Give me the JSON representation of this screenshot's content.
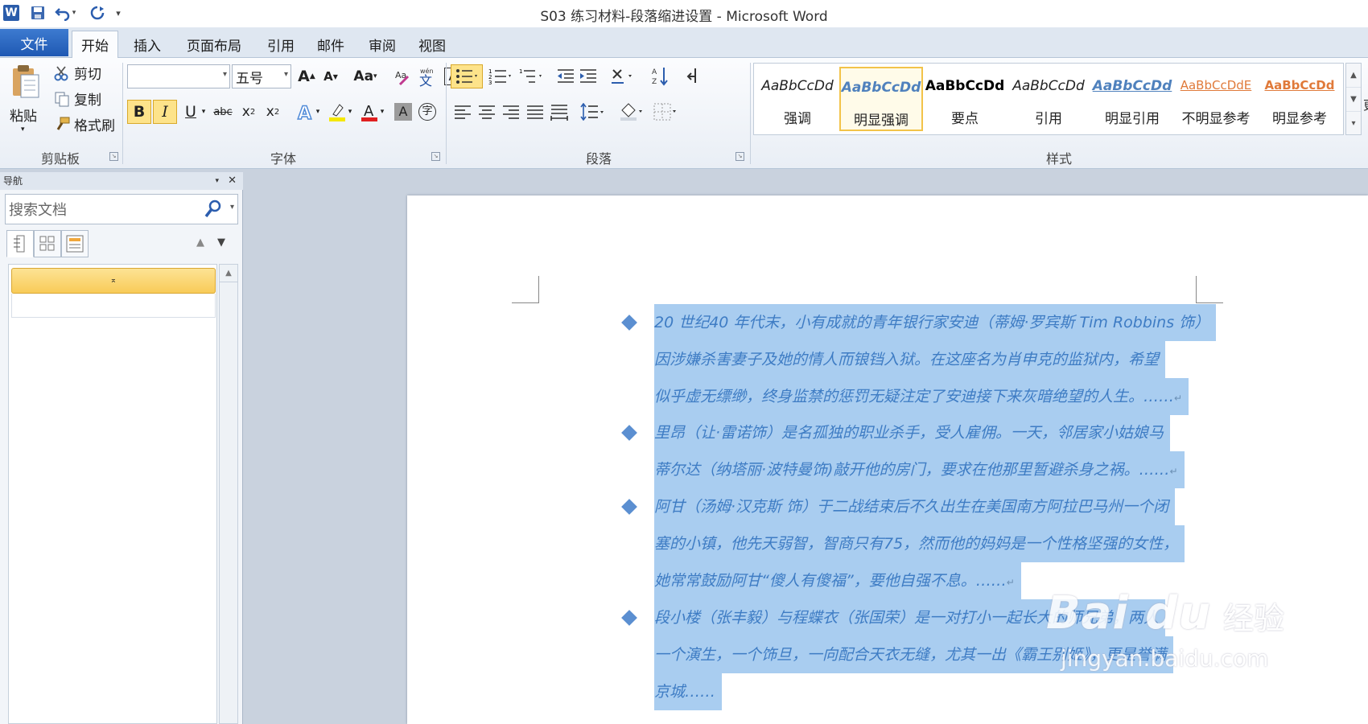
{
  "window": {
    "title": "S03 练习材料-段落缩进设置 - Microsoft Word",
    "app_icon": "W"
  },
  "tabs": {
    "file": "文件",
    "items": [
      "开始",
      "插入",
      "页面布局",
      "引用",
      "邮件",
      "审阅",
      "视图"
    ]
  },
  "ribbon": {
    "clipboard": {
      "paste": "粘贴",
      "cut": "剪切",
      "copy": "复制",
      "format_painter": "格式刷",
      "group_label": "剪贴板"
    },
    "font": {
      "font_name": "",
      "font_size": "五号",
      "group_label": "字体"
    },
    "paragraph": {
      "group_label": "段落"
    },
    "styles": {
      "group_label": "样式",
      "items": [
        {
          "sample": "AaBbCcDd",
          "name": "强调",
          "color": "#222222"
        },
        {
          "sample": "AaBbCcDd",
          "name": "明显强调",
          "color": "#4f81bd"
        },
        {
          "sample": "AaBbCcDd",
          "name": "要点",
          "color": "#000000"
        },
        {
          "sample": "AaBbCcDd",
          "name": "引用",
          "color": "#222222"
        },
        {
          "sample": "AaBbCcDd",
          "name": "明显引用",
          "color": "#4f81bd"
        },
        {
          "sample": "AaBbCcDdE",
          "name": "不明显参考",
          "color": "#e07a3a"
        },
        {
          "sample": "AaBbCcDd",
          "name": "明显参考",
          "color": "#e07a3a"
        }
      ],
      "selected_index": 1,
      "more_label": "更"
    }
  },
  "nav": {
    "title": "导航",
    "search_placeholder": "搜索文档",
    "heading_marker": "⌅"
  },
  "document": {
    "paragraphs": [
      {
        "lines": [
          "20 世纪40 年代末，小有成就的青年银行家安迪（蒂姆·罗宾斯 Tim Robbins  饰）",
          "因涉嫌杀害妻子及她的情人而锒铛入狱。在这座名为肖申克的监狱内，希望",
          "似乎虚无缥缈，终身监禁的惩罚无疑注定了安迪接下来灰暗绝望的人生。……"
        ]
      },
      {
        "lines": [
          "里昂（让·雷诺饰）是名孤独的职业杀手，受人雇佣。一天，邻居家小姑娘马",
          "蒂尔达（纳塔丽·波特曼饰)敲开他的房门，要求在他那里暂避杀身之祸。……"
        ]
      },
      {
        "lines": [
          "阿甘（汤姆·汉克斯  饰）于二战结束后不久出生在美国南方阿拉巴马州一个闭",
          "塞的小镇，他先天弱智，智商只有75，然而他的妈妈是一个性格坚强的女性，",
          "她常常鼓励阿甘“傻人有傻福”，要他自强不息。……"
        ]
      },
      {
        "lines": [
          "段小楼（张丰毅）与程蝶衣（张国荣）是一对打小一起长大的师兄弟，两人",
          "一个演生，一个饰旦，一向配合天衣无缝，尤其一出《霸王别姬》，更是誉满",
          "京城……"
        ]
      }
    ],
    "return_mark": "↵"
  },
  "watermark": {
    "logo": "Bai du",
    "brand_cn": "经验",
    "url": "jingyan.baidu.com"
  }
}
